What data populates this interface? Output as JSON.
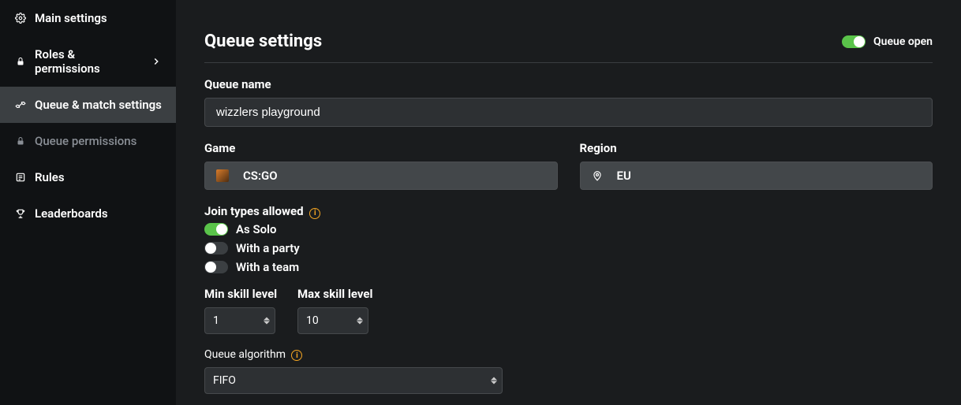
{
  "sidebar": {
    "items": [
      {
        "label": "Main settings",
        "icon": "gear-icon"
      },
      {
        "label": "Roles & permissions",
        "icon": "lock-icon",
        "expandable": true
      },
      {
        "label": "Queue & match settings",
        "icon": "tools-icon",
        "active": true
      },
      {
        "label": "Queue permissions",
        "icon": "lock-icon",
        "sub": true
      },
      {
        "label": "Rules",
        "icon": "list-icon"
      },
      {
        "label": "Leaderboards",
        "icon": "trophy-icon"
      }
    ]
  },
  "page": {
    "title": "Queue settings",
    "queue_open": {
      "label": "Queue open",
      "value": true
    }
  },
  "fields": {
    "queue_name": {
      "label": "Queue name",
      "value": "wizzlers playground"
    },
    "game": {
      "label": "Game",
      "value": "CS:GO"
    },
    "region": {
      "label": "Region",
      "value": "EU"
    },
    "join_types": {
      "label": "Join types allowed",
      "options": [
        {
          "label": "As Solo",
          "value": true
        },
        {
          "label": "With a party",
          "value": false
        },
        {
          "label": "With a team",
          "value": false
        }
      ]
    },
    "min_skill": {
      "label": "Min skill level",
      "value": "1"
    },
    "max_skill": {
      "label": "Max skill level",
      "value": "10"
    },
    "algorithm": {
      "label": "Queue algorithm",
      "value": "FIFO"
    }
  }
}
